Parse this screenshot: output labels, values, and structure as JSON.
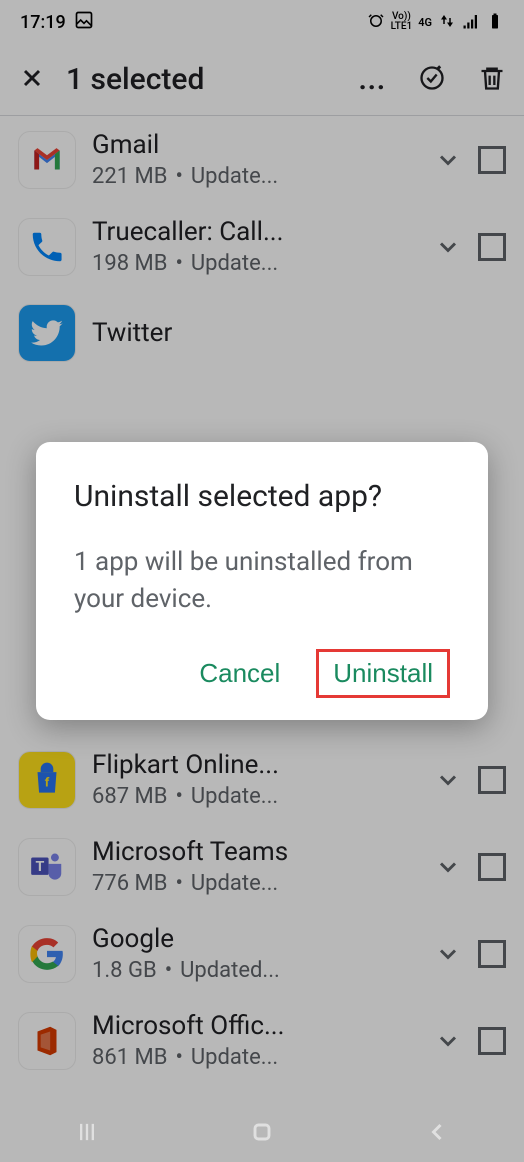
{
  "status": {
    "time": "17:19",
    "net_label": "4G",
    "lte_label": "LTE1"
  },
  "header": {
    "title": "1 selected"
  },
  "apps": [
    {
      "name": "Gmail",
      "size": "221 MB",
      "status": "Update..."
    },
    {
      "name": "Truecaller: Call...",
      "size": "198 MB",
      "status": "Update..."
    },
    {
      "name": "Twitter",
      "size": "",
      "status": ""
    },
    {
      "name": "Flipkart Online...",
      "size": "687 MB",
      "status": "Update..."
    },
    {
      "name": "Microsoft Teams",
      "size": "776 MB",
      "status": "Update..."
    },
    {
      "name": "Google",
      "size": "1.8 GB",
      "status": "Updated..."
    },
    {
      "name": "Microsoft Offic...",
      "size": "861 MB",
      "status": "Update..."
    }
  ],
  "dialog": {
    "title": "Uninstall selected app?",
    "body": "1 app will be uninstalled from your device.",
    "cancel": "Cancel",
    "confirm": "Uninstall"
  }
}
